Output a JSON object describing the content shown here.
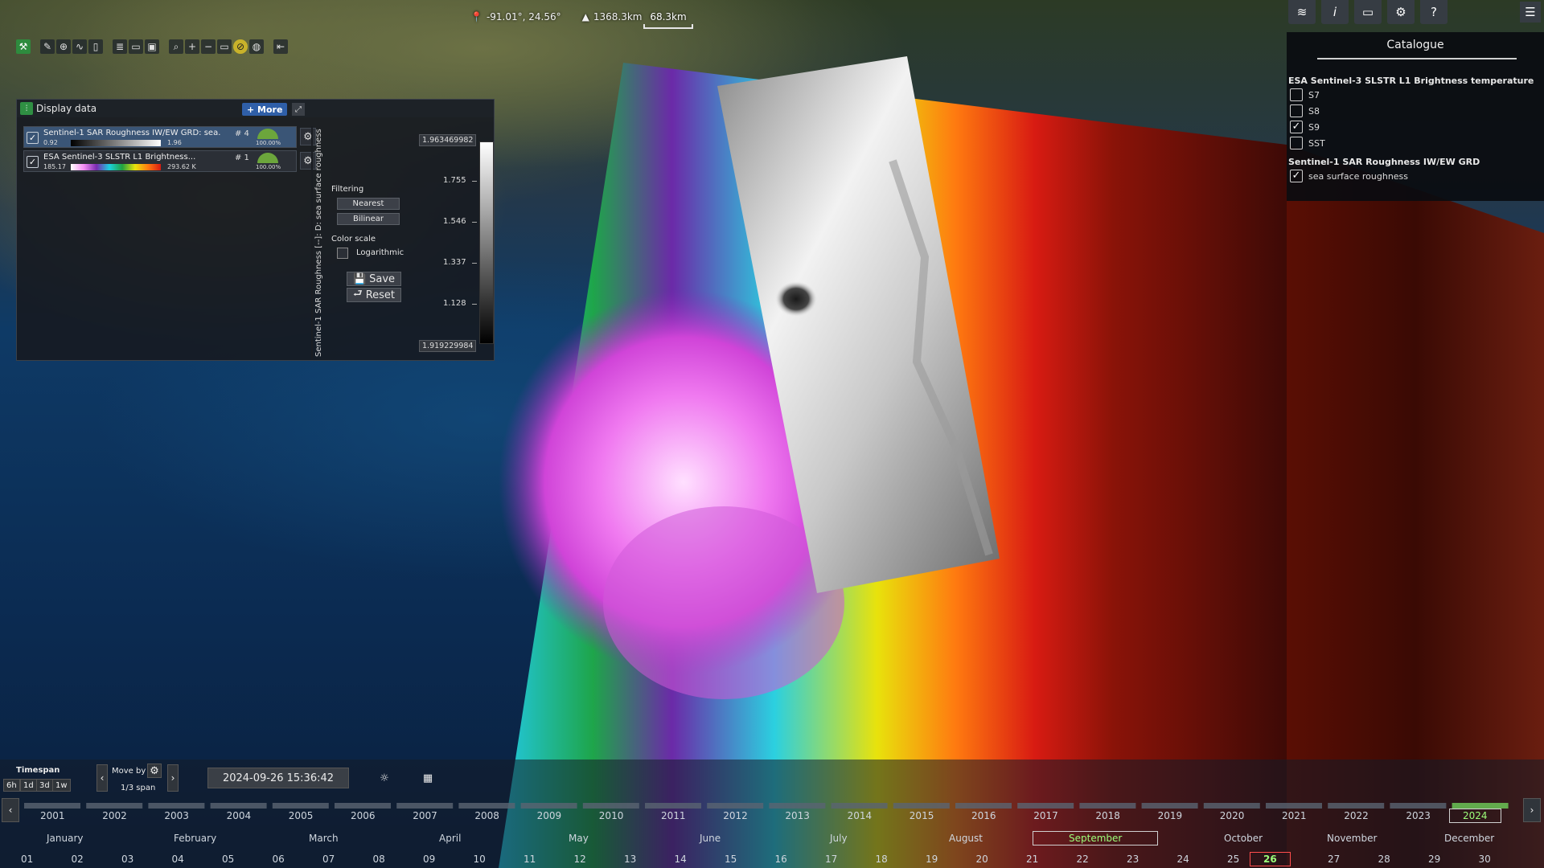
{
  "top_readout": {
    "coords": "-91.01°, 24.56°",
    "altitude": "1368.3km",
    "scale": "68.3km"
  },
  "display_panel": {
    "title": "Display data",
    "more_label": "+ More",
    "layers": [
      {
        "name": "Sentinel-1 SAR Roughness IW/EW GRD: sea...",
        "index": "# 4",
        "min": "0.92",
        "max": "1.96",
        "opacity": "100.00%",
        "checked": true
      },
      {
        "name": "ESA Sentinel-3 SLSTR L1 Brightness...",
        "index": "# 1",
        "min": "185.17",
        "max": "293.62  K",
        "opacity": "100.00%",
        "checked": true
      }
    ],
    "vertical_label": "Sentinel-1 SAR Roughness  [--]: D: sea surface roughness",
    "filtering_label": "Filtering",
    "nearest_label": "Nearest",
    "bilinear_label": "Bilinear",
    "color_scale_label": "Color scale",
    "logarithmic_label": "Logarithmic",
    "save_label": "Save",
    "reset_label": "Reset",
    "legend": {
      "max": "1.963469982",
      "min": "1.919229984",
      "ticks": [
        "1.755",
        "1.546",
        "1.337",
        "1.128"
      ]
    }
  },
  "catalogue": {
    "title": "Catalogue",
    "group1": "ESA Sentinel-3 SLSTR L1 Brightness temperature",
    "group1_items": [
      {
        "label": "S7",
        "checked": false
      },
      {
        "label": "S8",
        "checked": false
      },
      {
        "label": "S9",
        "checked": true
      },
      {
        "label": "SST",
        "checked": false
      }
    ],
    "group2": "Sentinel-1 SAR Roughness IW/EW GRD",
    "group2_items": [
      {
        "label": "sea surface roughness",
        "checked": true
      }
    ]
  },
  "timeline": {
    "timespan_label": "Timespan",
    "spans": [
      "6h",
      "1d",
      "3d",
      "1w"
    ],
    "move_by_label": "Move by",
    "span_value": "1/3 span",
    "datetime": "2024-09-26 15:36:42",
    "years": [
      "2001",
      "2002",
      "2003",
      "2004",
      "2005",
      "2006",
      "2007",
      "2008",
      "2009",
      "2010",
      "2011",
      "2012",
      "2013",
      "2014",
      "2015",
      "2016",
      "2017",
      "2018",
      "2019",
      "2020",
      "2021",
      "2022",
      "2023",
      "2024"
    ],
    "current_year": "2024",
    "months": [
      "January",
      "February",
      "March",
      "April",
      "May",
      "June",
      "July",
      "August",
      "September",
      "October",
      "November",
      "December"
    ],
    "current_month": "September",
    "days": [
      "01",
      "02",
      "03",
      "04",
      "05",
      "06",
      "07",
      "08",
      "09",
      "10",
      "11",
      "12",
      "13",
      "14",
      "15",
      "16",
      "17",
      "18",
      "19",
      "20",
      "21",
      "22",
      "23",
      "24",
      "25",
      "26",
      "27",
      "28",
      "29",
      "30"
    ],
    "current_day": "26"
  },
  "icons": {
    "toolbar": [
      "tools-icon",
      "pencil-icon",
      "crosshair-icon",
      "chart-icon",
      "panel-icon",
      "layers-icon",
      "folder-icon",
      "save-icon",
      "search-icon",
      "zoom-in-icon",
      "zoom-out-icon",
      "ruler-icon",
      "globe-2d-icon",
      "globe-icon",
      "back-icon"
    ],
    "top_right": [
      "layers-icon",
      "info-icon",
      "screen-icon",
      "gear-icon",
      "help-icon",
      "menu-icon"
    ]
  },
  "colors": {
    "accent_green": "#2e8b3e",
    "more_blue": "#2f5fa8",
    "current_highlight": "#9cff7a",
    "current_day_border": "#ff4d4d"
  }
}
